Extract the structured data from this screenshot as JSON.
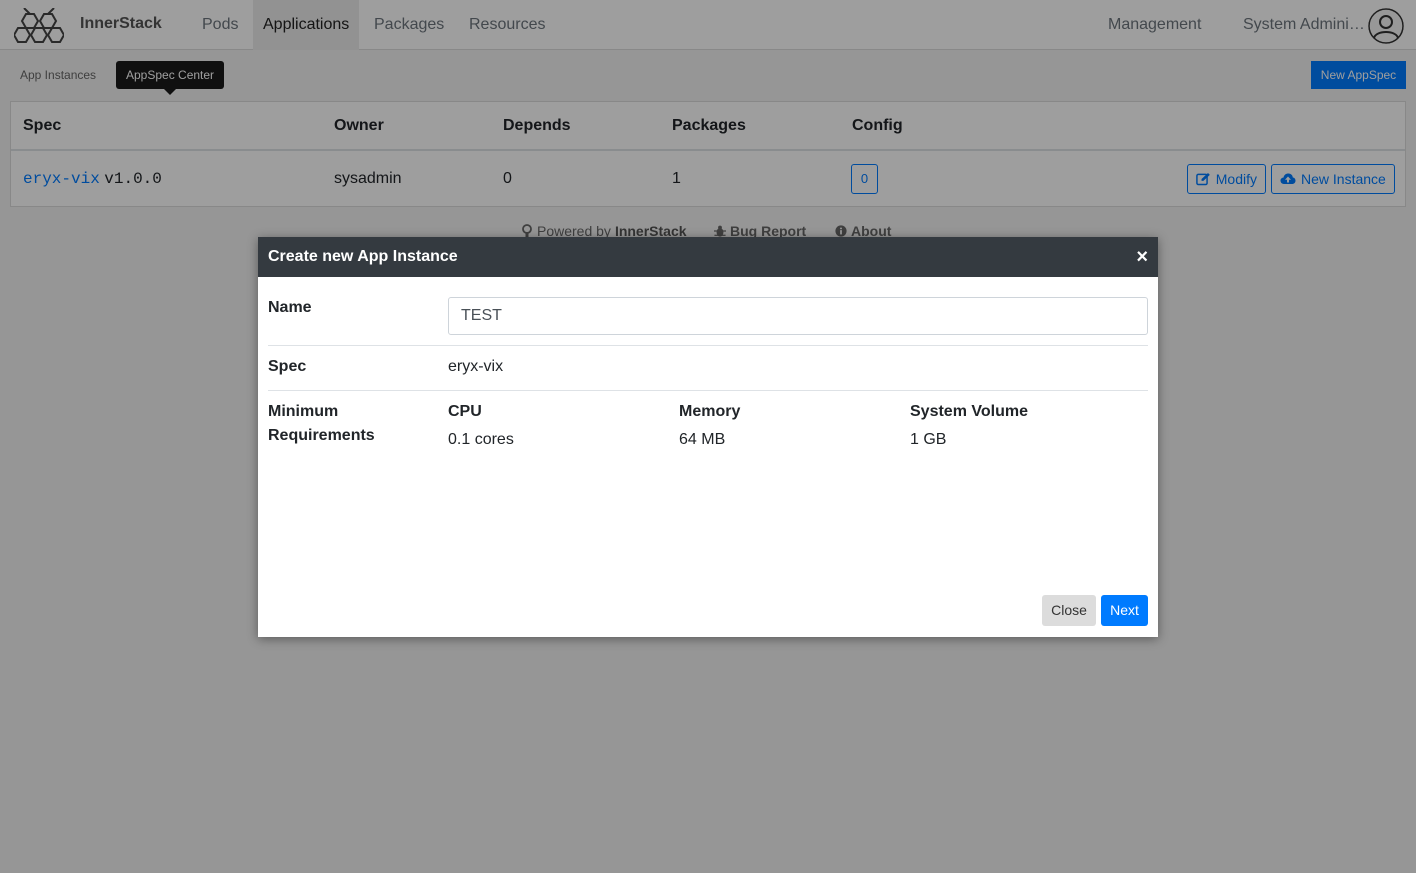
{
  "header": {
    "brand": "InnerStack",
    "nav": [
      "Pods",
      "Applications",
      "Packages",
      "Resources"
    ],
    "management": "Management",
    "user": "System Administrator"
  },
  "subnav": {
    "instances": "App Instances",
    "spec_center": "AppSpec Center",
    "new_spec": "New AppSpec"
  },
  "table": {
    "columns": [
      "Spec",
      "Owner",
      "Depends",
      "Packages",
      "Config"
    ],
    "rows": [
      {
        "spec_name": "eryx-vix",
        "spec_version": "v1.0.0",
        "owner": "sysadmin",
        "depends": "0",
        "packages": "1",
        "config": "0",
        "modify": "Modify",
        "new_instance": "New Instance"
      }
    ]
  },
  "footer": {
    "powered_prefix": "Powered by",
    "powered_brand": "InnerStack",
    "bug_report": "Bug Report",
    "about": "About"
  },
  "modal": {
    "title": "Create new App Instance",
    "close_x": "×",
    "name_label": "Name",
    "name_value": "TEST",
    "spec_label": "Spec",
    "spec_value": "eryx-vix",
    "req_label": "Minimum Requirements",
    "requirements": [
      {
        "label": "CPU",
        "value": "0.1 cores"
      },
      {
        "label": "Memory",
        "value": "64 MB"
      },
      {
        "label": "System Volume",
        "value": "1 GB"
      }
    ],
    "close_btn": "Close",
    "next_btn": "Next"
  },
  "colors": {
    "primary": "#007bff",
    "modal_header": "#343a40",
    "tooltip": "#1b1b1b"
  }
}
